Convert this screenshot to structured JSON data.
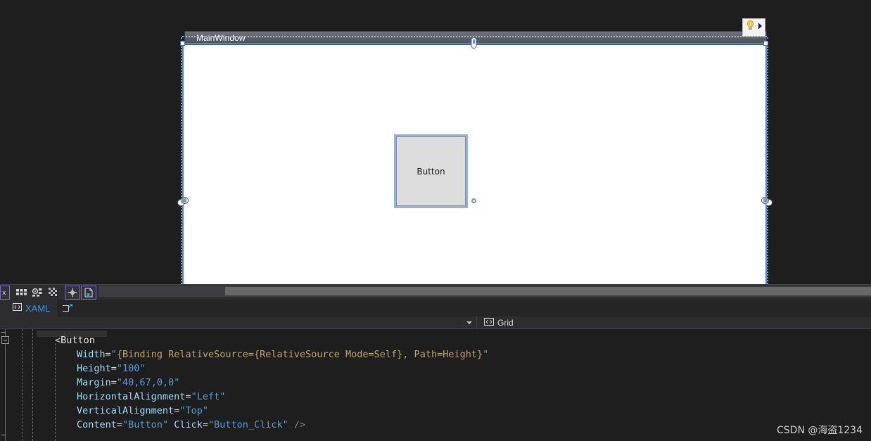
{
  "designer": {
    "window_title": "MainWindow",
    "button": {
      "label": "Button"
    },
    "quick_actions": {
      "icon": "lightbulb-icon",
      "expander_icon": "triangle-right-icon"
    },
    "toolbar": {
      "buttons": [
        {
          "name": "zoom-level-button",
          "icon": "zoom-x-icon"
        },
        {
          "name": "show-grid-button",
          "icon": "grid-icon"
        },
        {
          "name": "snap-to-gridlines-button",
          "icon": "snap-grid-icon"
        },
        {
          "name": "snap-to-snaplines-button",
          "icon": "checker-icon"
        },
        {
          "name": "alignment-guides-button",
          "icon": "crosshair-icon"
        },
        {
          "name": "artboard-background-button",
          "icon": "artboard-icon"
        },
        {
          "name": "collapse-pane-button",
          "icon": "triangle-left-icon"
        }
      ]
    }
  },
  "xaml_tab": {
    "label": "XAML",
    "icon": "code-icon",
    "popout_icon": "popout-window-icon"
  },
  "element_bar": {
    "dropdown_icon": "chevron-down-icon",
    "element_icon": "code-brackets-icon",
    "element_name": "Grid"
  },
  "code": {
    "lines": [
      {
        "indent": 0,
        "tokens": [
          {
            "t": "punct",
            "v": "<"
          },
          {
            "t": "tag",
            "v": "Button"
          }
        ]
      },
      {
        "indent": 1,
        "tokens": [
          {
            "t": "attr",
            "v": "Width"
          },
          {
            "t": "eq",
            "v": "="
          },
          {
            "t": "val",
            "v": "\""
          },
          {
            "t": "markup",
            "v": "{Binding RelativeSource={RelativeSource Mode=Self}, Path=Height}"
          },
          {
            "t": "val",
            "v": "\""
          }
        ]
      },
      {
        "indent": 1,
        "tokens": [
          {
            "t": "attr",
            "v": "Height"
          },
          {
            "t": "eq",
            "v": "="
          },
          {
            "t": "val",
            "v": "\"100\""
          }
        ]
      },
      {
        "indent": 1,
        "tokens": [
          {
            "t": "attr",
            "v": "Margin"
          },
          {
            "t": "eq",
            "v": "="
          },
          {
            "t": "val",
            "v": "\"40,67,0,0\""
          }
        ]
      },
      {
        "indent": 1,
        "tokens": [
          {
            "t": "attr",
            "v": "HorizontalAlignment"
          },
          {
            "t": "eq",
            "v": "="
          },
          {
            "t": "val",
            "v": "\"Left\""
          }
        ]
      },
      {
        "indent": 1,
        "tokens": [
          {
            "t": "attr",
            "v": "VerticalAlignment"
          },
          {
            "t": "eq",
            "v": "="
          },
          {
            "t": "val",
            "v": "\"Top\""
          }
        ]
      },
      {
        "indent": 1,
        "tokens": [
          {
            "t": "attr",
            "v": "Content"
          },
          {
            "t": "eq",
            "v": "="
          },
          {
            "t": "val",
            "v": "\"Button\""
          },
          {
            "t": "eq",
            "v": " "
          },
          {
            "t": "attr",
            "v": "Click"
          },
          {
            "t": "eq",
            "v": "="
          },
          {
            "t": "val",
            "v": "\"Button_Click\""
          },
          {
            "t": "close",
            "v": " />"
          }
        ]
      }
    ]
  },
  "watermark": {
    "text": "CSDN @海盗1234"
  },
  "colors": {
    "editor_background": "#1e1e1e",
    "chrome_background": "#2d2d30",
    "accent_blue": "#3a96dd",
    "selection_blue": "#5b84c4",
    "attribute": "#9cdcfe",
    "value": "#569cd6",
    "markup_extension": "#c8a165"
  }
}
